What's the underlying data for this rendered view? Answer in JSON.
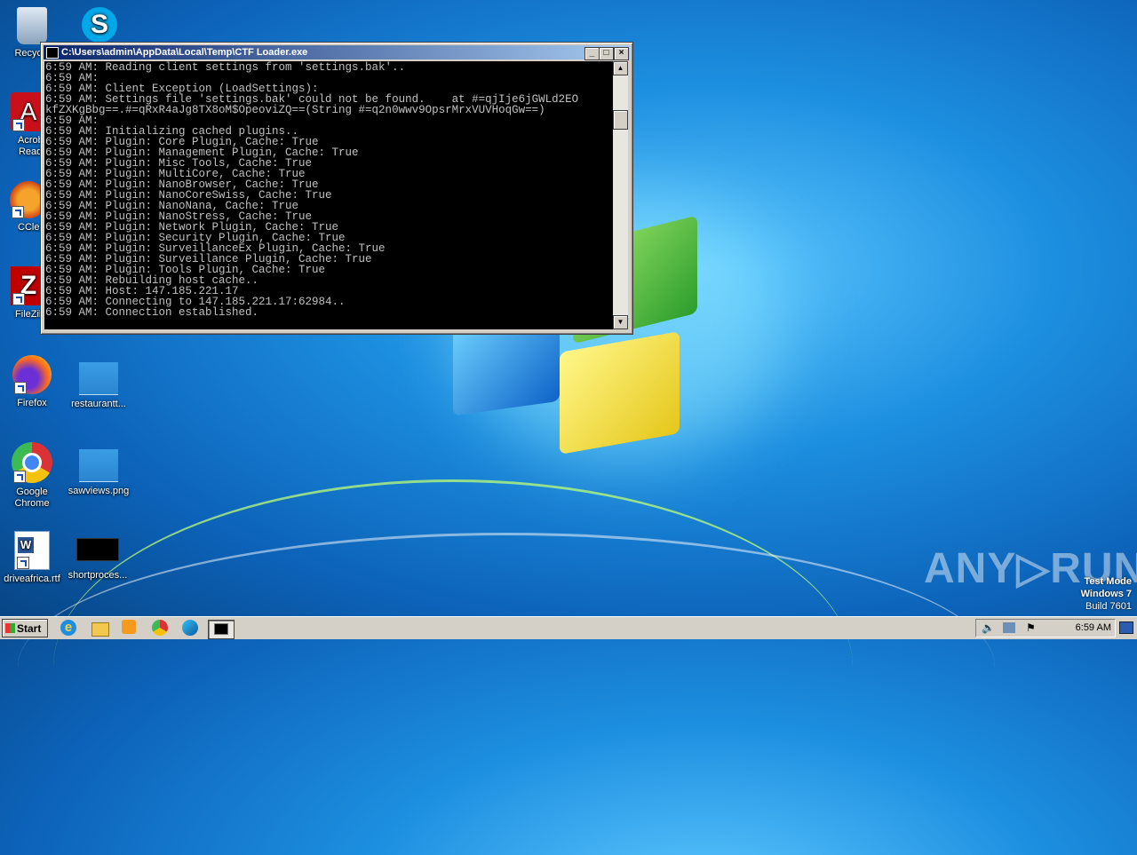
{
  "desktop": {
    "icons": [
      {
        "label": "Recycle"
      },
      {
        "label": ""
      },
      {
        "label": "Acrobat Reader"
      },
      {
        "label": "CCleaner"
      },
      {
        "label": "FileZilla"
      },
      {
        "label": "Firefox"
      },
      {
        "label": "restaurantt..."
      },
      {
        "label": "Google Chrome"
      },
      {
        "label": "sawviews.png"
      },
      {
        "label": "driveafrica.rtf"
      },
      {
        "label": "shortproces..."
      }
    ]
  },
  "window": {
    "title": "C:\\Users\\admin\\AppData\\Local\\Temp\\CTF Loader.exe",
    "minimize": "_",
    "maximize": "□",
    "close": "×",
    "lines": [
      "6:59 AM: Reading client settings from 'settings.bak'..",
      "6:59 AM:",
      "6:59 AM: Client Exception (LoadSettings):",
      "6:59 AM: Settings file 'settings.bak' could not be found.    at #=qjIje6jGWLd2EO",
      "kfZXKgBbg==.#=qRxR4aJg8TX8oM$OpeoviZQ==(String #=q2n0wwv9OpsrMrxVUVHoqGw==)",
      "6:59 AM:",
      "6:59 AM: Initializing cached plugins..",
      "6:59 AM: Plugin: Core Plugin, Cache: True",
      "6:59 AM: Plugin: Management Plugin, Cache: True",
      "6:59 AM: Plugin: Misc Tools, Cache: True",
      "6:59 AM: Plugin: MultiCore, Cache: True",
      "6:59 AM: Plugin: NanoBrowser, Cache: True",
      "6:59 AM: Plugin: NanoCoreSwiss, Cache: True",
      "6:59 AM: Plugin: NanoNana, Cache: True",
      "6:59 AM: Plugin: NanoStress, Cache: True",
      "6:59 AM: Plugin: Network Plugin, Cache: True",
      "6:59 AM: Plugin: Security Plugin, Cache: True",
      "6:59 AM: Plugin: SurveillanceEx Plugin, Cache: True",
      "6:59 AM: Plugin: Surveillance Plugin, Cache: True",
      "6:59 AM: Plugin: Tools Plugin, Cache: True",
      "6:59 AM: Rebuilding host cache..",
      "6:59 AM: Host: 147.185.221.17",
      "6:59 AM: Connecting to 147.185.221.17:62984..",
      "6:59 AM: Connection established."
    ]
  },
  "watermark": {
    "brand": "ANY▷RUN"
  },
  "os_info": {
    "line1": "Test Mode",
    "line2": "Windows 7",
    "line3": "Build 7601"
  },
  "taskbar": {
    "start_label": "Start",
    "clock": "6:59 AM"
  },
  "colors": {
    "console_bg": "#000000",
    "console_fg": "#c0c0c0",
    "title_start": "#0a246a",
    "title_end": "#a6caf0"
  }
}
